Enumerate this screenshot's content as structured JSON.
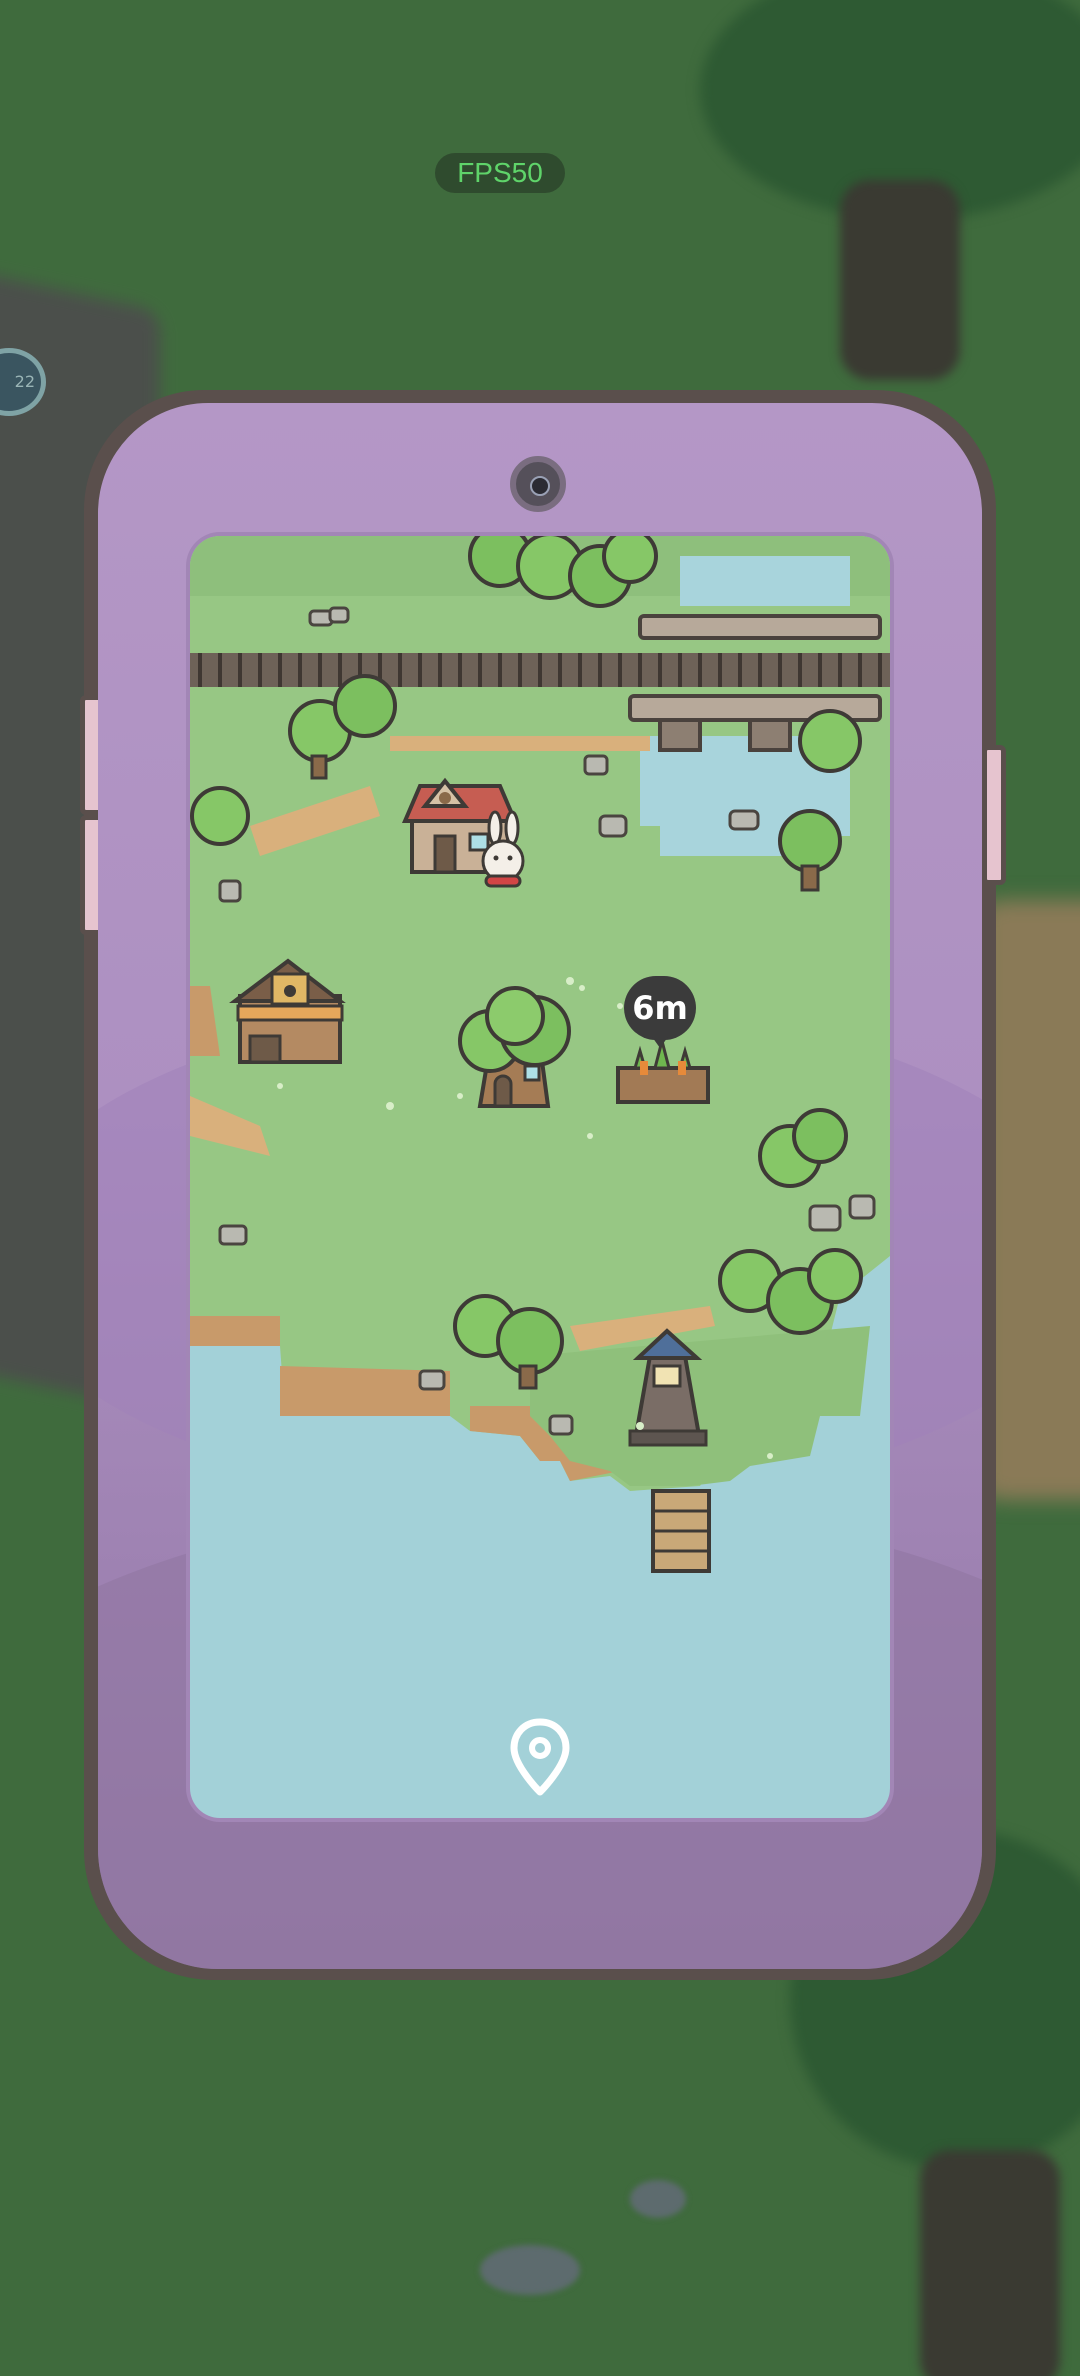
{
  "hud": {
    "fps_label": "FPS50",
    "side_badge_text": "22"
  },
  "phone_map": {
    "distance_marker": "6m",
    "icons": {
      "camera": "camera-icon",
      "location": "location-pin-icon",
      "rabbit": "rabbit-player-icon",
      "carrot_patch": "carrot-patch-icon",
      "lighthouse": "lighthouse-icon",
      "shop": "paw-shop-icon",
      "house": "red-roof-house-icon",
      "tree_house": "tree-house-icon",
      "bridge": "stone-bridge-icon",
      "railway": "railway-track-icon",
      "pier": "wooden-pier-icon"
    }
  },
  "colors": {
    "phone_body": "#b497c6",
    "grass": "#97c784",
    "water": "#a3d1d8",
    "fps_text": "#5fd46a"
  }
}
